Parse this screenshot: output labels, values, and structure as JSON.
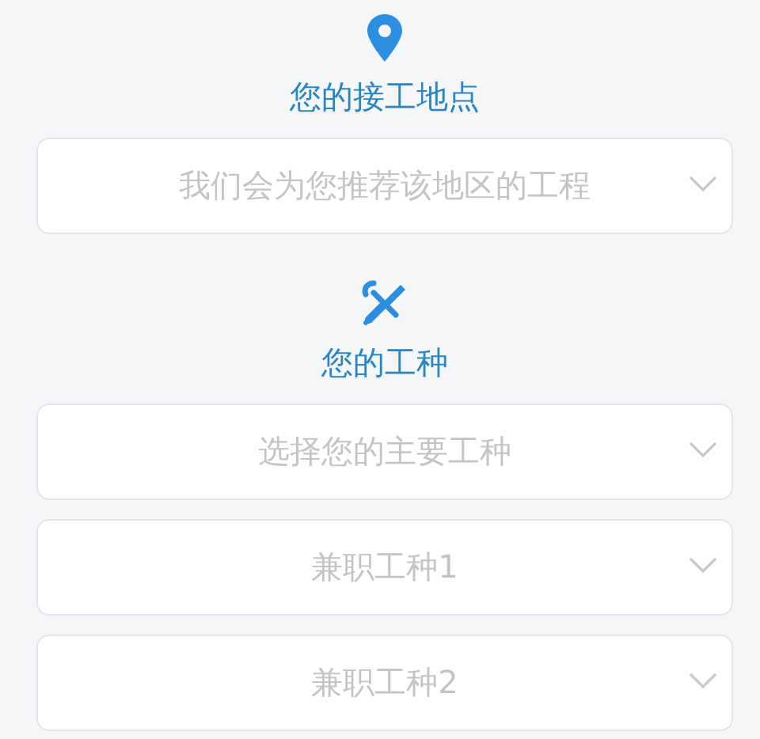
{
  "sections": [
    {
      "kind": "location",
      "title": "您的接工地点",
      "selects": [
        {
          "placeholder": "我们会为您推荐该地区的工程"
        }
      ]
    },
    {
      "kind": "trade",
      "title": "您的工种",
      "selects": [
        {
          "placeholder": "选择您的主要工种"
        },
        {
          "placeholder": "兼职工种1"
        },
        {
          "placeholder": "兼职工种2"
        }
      ]
    }
  ]
}
